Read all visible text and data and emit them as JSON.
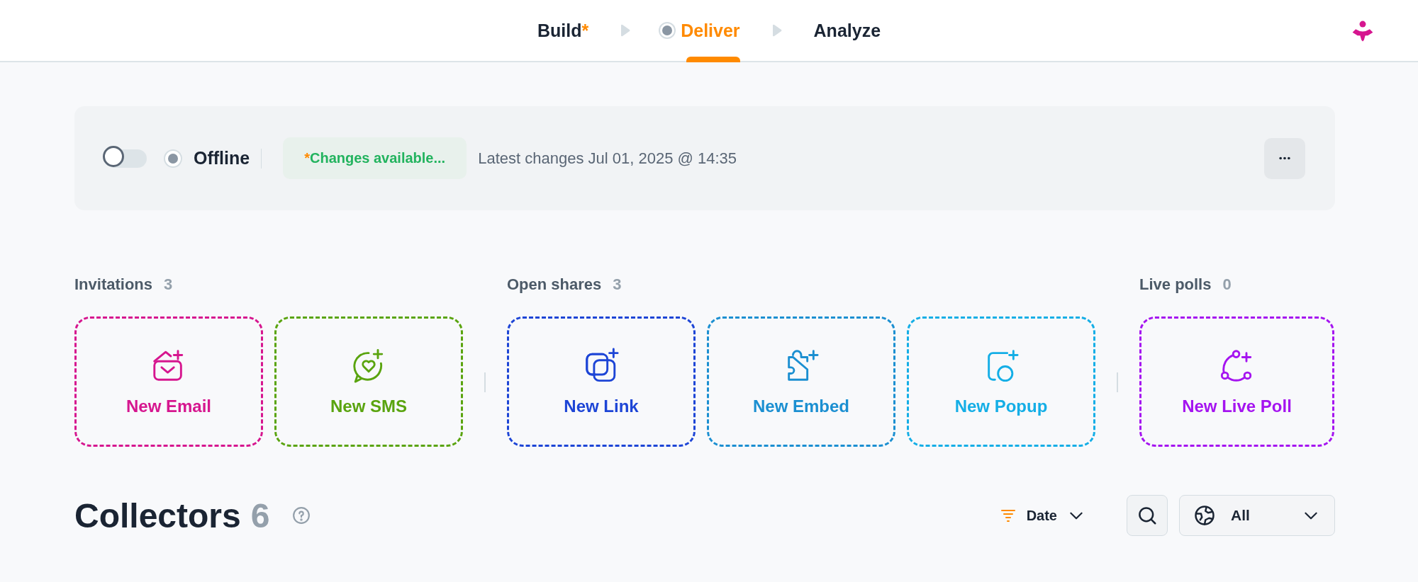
{
  "steps": [
    {
      "label": "Build",
      "marker": "*",
      "selected": false
    },
    {
      "label": "Deliver",
      "selected": true
    },
    {
      "label": "Analyze",
      "selected": false
    }
  ],
  "status_card": {
    "toggle": {
      "on": false
    },
    "status": "Offline",
    "changes_badge": {
      "marker": "*",
      "text": "Changes available..."
    },
    "latest": "Latest changes Jul 01, 2025 @ 14:35"
  },
  "sections": [
    {
      "title": "Invitations",
      "count": "3",
      "cards": [
        {
          "kind": "email",
          "label": "New Email",
          "color": "#d6168f"
        },
        {
          "kind": "sms",
          "label": "New SMS",
          "color": "#5aa40f"
        }
      ]
    },
    {
      "title": "Open shares",
      "count": "3",
      "cards": [
        {
          "kind": "link",
          "label": "New Link",
          "color": "#1d45d6"
        },
        {
          "kind": "embed",
          "label": "New Embed",
          "color": "#1b8fd1"
        },
        {
          "kind": "popup",
          "label": "New Popup",
          "color": "#14aee6"
        }
      ]
    },
    {
      "title": "Live polls",
      "count": "0",
      "cards": [
        {
          "kind": "poll",
          "label": "New Live Poll",
          "color": "#a514f0"
        }
      ]
    }
  ],
  "collectors": {
    "title": "Collectors",
    "count": "6",
    "sort": "Date",
    "filter": "All"
  }
}
